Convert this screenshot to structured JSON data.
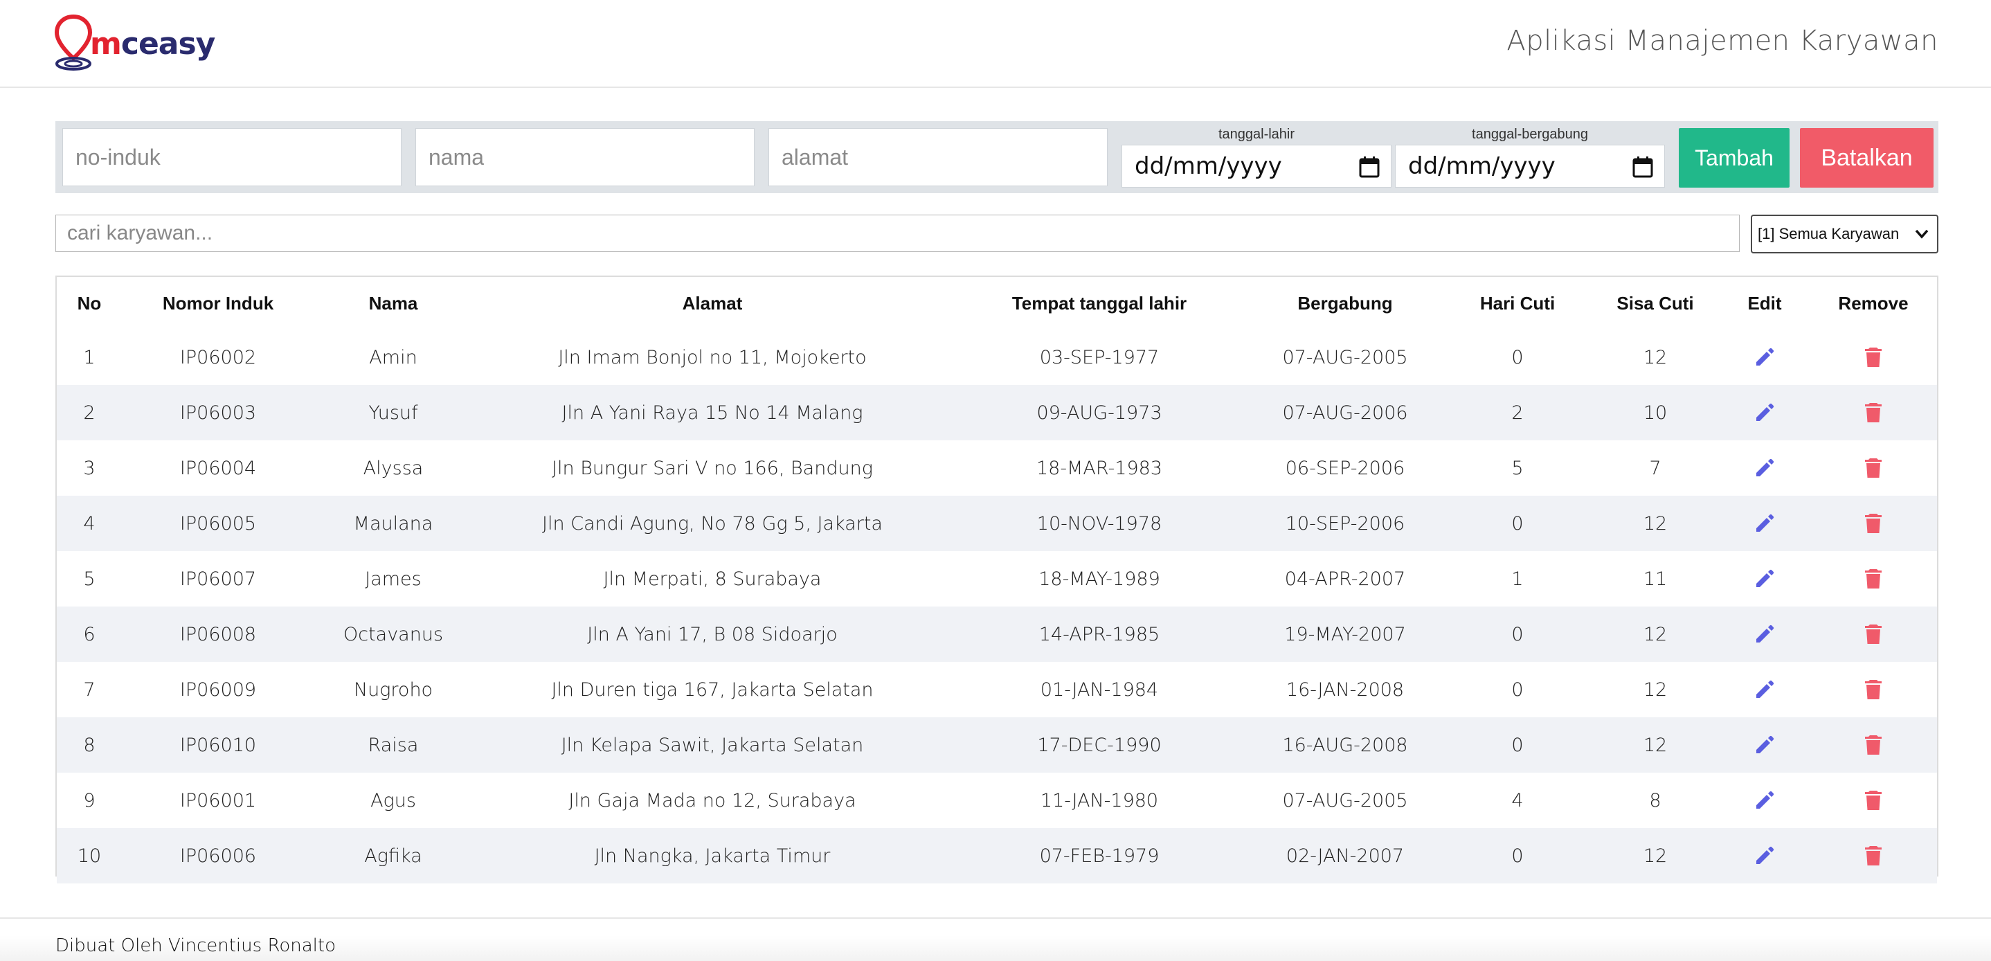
{
  "header": {
    "logo_text_red": "m",
    "logo_text_rest": "ceasy",
    "app_title": "Aplikasi Manajemen Karyawan"
  },
  "form": {
    "no_induk_placeholder": "no-induk",
    "nama_placeholder": "nama",
    "alamat_placeholder": "alamat",
    "tanggal_lahir_label": "tanggal-lahir",
    "tanggal_lahir_value": "dd/mm/yyyy",
    "tanggal_bergabung_label": "tanggal-bergabung",
    "tanggal_bergabung_value": "dd/mm/yyyy",
    "tambah_label": "Tambah",
    "batalkan_label": "Batalkan"
  },
  "search": {
    "placeholder": "cari karyawan...",
    "filter_selected": "[1] Semua Karyawan"
  },
  "table": {
    "headers": [
      "No",
      "Nomor Induk",
      "Nama",
      "Alamat",
      "Tempat tanggal lahir",
      "Bergabung",
      "Hari Cuti",
      "Sisa Cuti",
      "Edit",
      "Remove"
    ],
    "rows": [
      [
        "1",
        "IP06002",
        "Amin",
        "Jln Imam Bonjol no 11, Mojokerto",
        "03-SEP-1977",
        "07-AUG-2005",
        "0",
        "12"
      ],
      [
        "2",
        "IP06003",
        "Yusuf",
        "Jln A Yani Raya 15 No 14 Malang",
        "09-AUG-1973",
        "07-AUG-2006",
        "2",
        "10"
      ],
      [
        "3",
        "IP06004",
        "Alyssa",
        "Jln Bungur Sari V no 166, Bandung",
        "18-MAR-1983",
        "06-SEP-2006",
        "5",
        "7"
      ],
      [
        "4",
        "IP06005",
        "Maulana",
        "Jln Candi Agung, No 78 Gg 5, Jakarta",
        "10-NOV-1978",
        "10-SEP-2006",
        "0",
        "12"
      ],
      [
        "5",
        "IP06007",
        "James",
        "Jln Merpati, 8 Surabaya",
        "18-MAY-1989",
        "04-APR-2007",
        "1",
        "11"
      ],
      [
        "6",
        "IP06008",
        "Octavanus",
        "Jln A Yani 17, B 08 Sidoarjo",
        "14-APR-1985",
        "19-MAY-2007",
        "0",
        "12"
      ],
      [
        "7",
        "IP06009",
        "Nugroho",
        "Jln Duren tiga 167, Jakarta Selatan",
        "01-JAN-1984",
        "16-JAN-2008",
        "0",
        "12"
      ],
      [
        "8",
        "IP06010",
        "Raisa",
        "Jln Kelapa Sawit, Jakarta Selatan",
        "17-DEC-1990",
        "16-AUG-2008",
        "0",
        "12"
      ],
      [
        "9",
        "IP06001",
        "Agus",
        "Jln Gaja Mada no 12, Surabaya",
        "11-JAN-1980",
        "07-AUG-2005",
        "4",
        "8"
      ],
      [
        "10",
        "IP06006",
        "Agfika",
        "Jln Nangka, Jakarta Timur",
        "07-FEB-1979",
        "02-JAN-2007",
        "0",
        "12"
      ]
    ]
  },
  "icons": {
    "edit": "pencil-icon",
    "remove": "trash-icon",
    "edit_color": "#5a5ee0",
    "remove_color": "#f05a6a"
  },
  "footer": {
    "text": "Dibuat Oleh Vincentius Ronalto"
  }
}
